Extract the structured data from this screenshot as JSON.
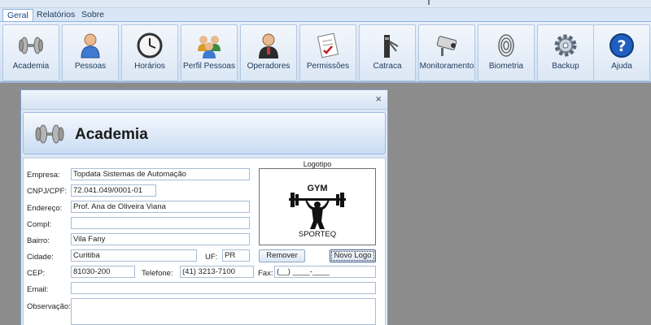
{
  "ribbon": {
    "tabs": [
      {
        "label": "Geral"
      },
      {
        "label": "Relatórios"
      },
      {
        "label": "Sobre"
      }
    ],
    "buttons": [
      {
        "label": "Academia",
        "icon": "dumbbell-icon"
      },
      {
        "label": "Pessoas",
        "icon": "person-icon"
      },
      {
        "label": "Horários",
        "icon": "clock-icon"
      },
      {
        "label": "Perfil Pessoas",
        "icon": "people-group-icon"
      },
      {
        "label": "Operadores",
        "icon": "operator-icon"
      },
      {
        "label": "Permissões",
        "icon": "permissions-icon"
      },
      {
        "label": "Catraca",
        "icon": "turnstile-icon"
      },
      {
        "label": "Monitoramento",
        "icon": "camera-icon"
      },
      {
        "label": "Biometria",
        "icon": "fingerprint-icon"
      },
      {
        "label": "Backup",
        "icon": "gear-icon"
      },
      {
        "label": "Ajuda",
        "icon": "help-icon"
      }
    ]
  },
  "dialog": {
    "close": "×",
    "title": "Academia",
    "form": {
      "empresa_label": "Empresa:",
      "empresa_value": "Topdata Sistemas de Automação",
      "cnpj_label": "CNPJ/CPF:",
      "cnpj_value": "72.041.049/0001-01",
      "endereco_label": "Endereço:",
      "endereco_value": "Prof. Ana de Oliveira Viana",
      "compl_label": "Compl:",
      "compl_value": "",
      "bairro_label": "Bairro:",
      "bairro_value": "Vila Fany",
      "cidade_label": "Cidade:",
      "cidade_value": "Curitiba",
      "uf_label": "UF:",
      "uf_value": "PR",
      "cep_label": "CEP:",
      "cep_value": "81030-200",
      "telefone_label": "Telefone:",
      "telefone_value": "(41) 3213-7100",
      "fax_label": "Fax:",
      "fax_value": "(__) ____-____",
      "email_label": "Email:",
      "email_value": "",
      "observacao_label": "Observação:",
      "observacao_value": ""
    },
    "logo": {
      "label": "Logotipo",
      "text_top": "GYM",
      "text_bottom": "SPORTEQ",
      "remove_button": "Remover",
      "new_button": "Novo Logo"
    }
  },
  "colors": {
    "ribbon_bg": "#cfdff2",
    "dialog_bg": "#dce7f5",
    "desktop_bg": "#8c8c8c",
    "accent": "#15428b"
  }
}
